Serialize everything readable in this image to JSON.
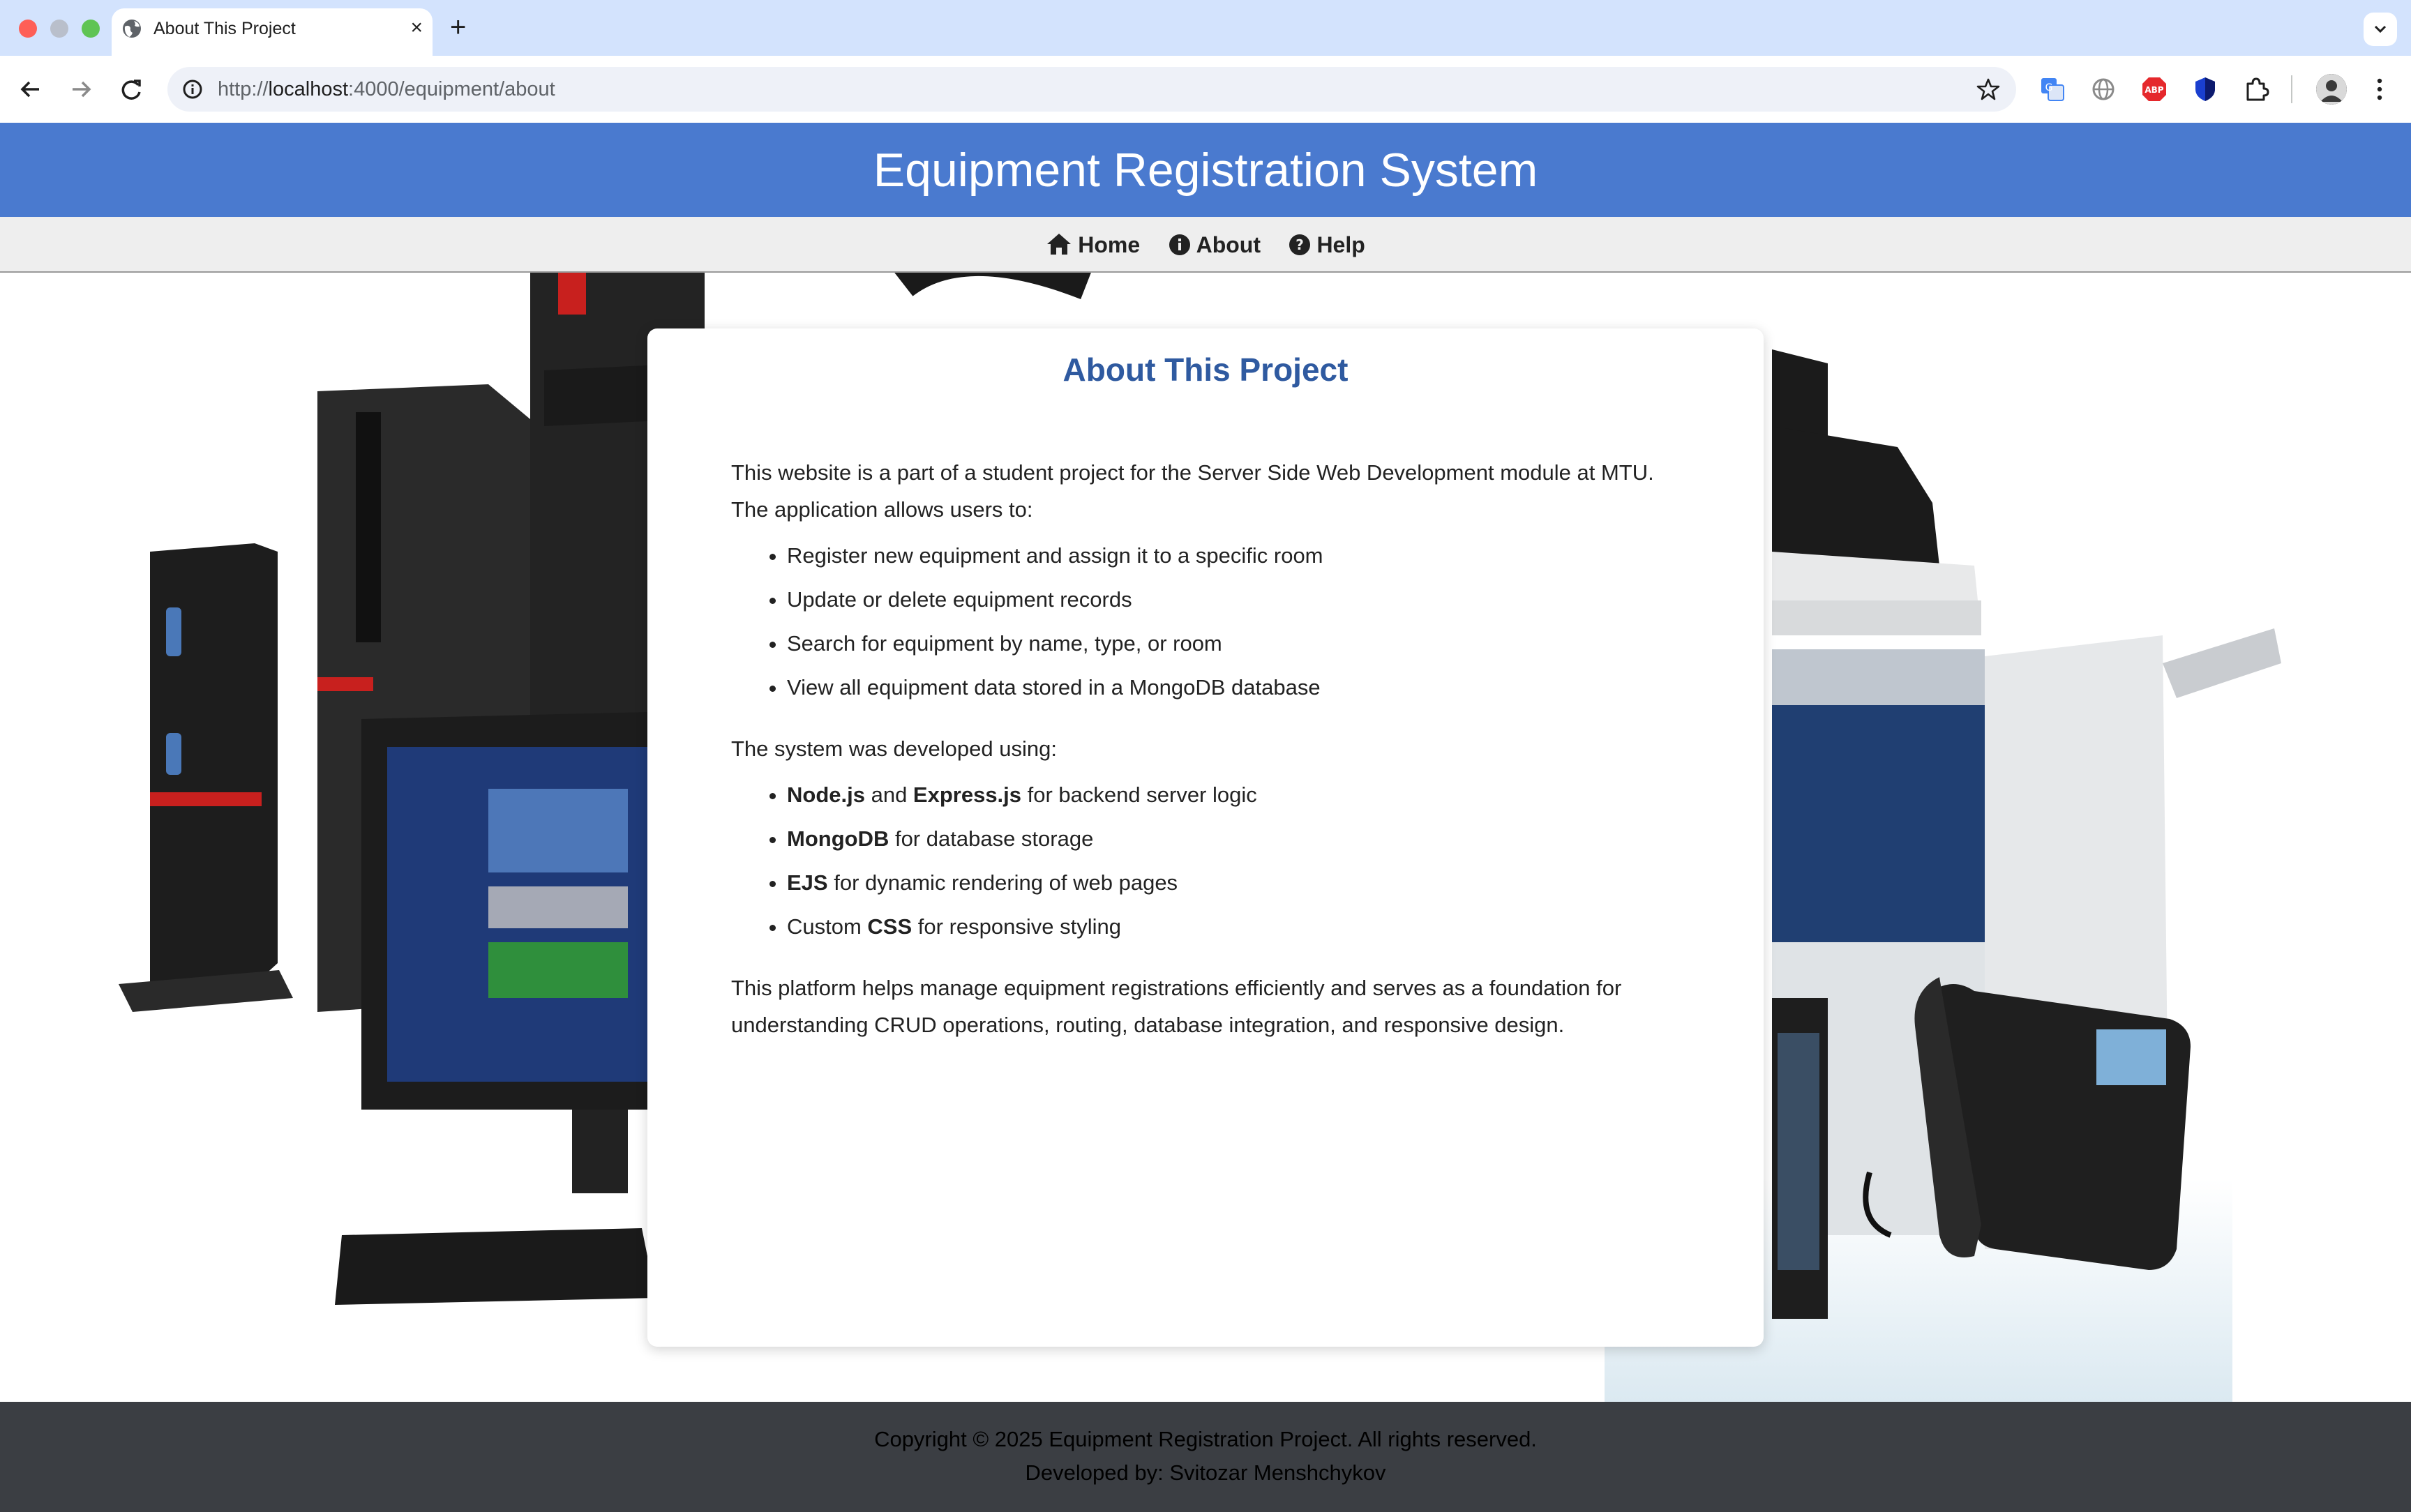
{
  "browser": {
    "tab_title": "About This Project",
    "tab_close": "×",
    "new_tab": "+",
    "tab_menu": "⌄",
    "url_scheme": "http://",
    "url_host": "localhost",
    "url_path": ":4000/equipment/about",
    "extensions": [
      "translate-icon",
      "globe-icon",
      "adblock-icon",
      "shield-icon",
      "puzzle-icon"
    ]
  },
  "header": {
    "title": "Equipment Registration System"
  },
  "nav": {
    "items": [
      {
        "label": "Home",
        "icon": "home-icon"
      },
      {
        "label": "About",
        "icon": "info-icon"
      },
      {
        "label": "Help",
        "icon": "help-icon"
      }
    ]
  },
  "content": {
    "title": "About This Project",
    "intro_1": "This website is a part of a student project for the Server Side Web Development module at MTU.",
    "intro_2": "The application allows users to:",
    "features": [
      "Register new equipment and assign it to a specific room",
      "Update or delete equipment records",
      "Search for equipment by name, type, or room",
      "View all equipment data stored in a MongoDB database"
    ],
    "tech_intro": "The system was developed using:",
    "tech": [
      {
        "pre": "",
        "b1": "Node.js",
        "mid": " and ",
        "b2": "Express.js",
        "post": " for backend server logic"
      },
      {
        "pre": "",
        "b1": "MongoDB",
        "mid": " for database storage",
        "b2": "",
        "post": ""
      },
      {
        "pre": "",
        "b1": "EJS",
        "mid": " for dynamic rendering of web pages",
        "b2": "",
        "post": ""
      },
      {
        "pre": "Custom ",
        "b1": "CSS",
        "mid": " for responsive styling",
        "b2": "",
        "post": ""
      }
    ],
    "outro_1": "This platform helps manage equipment registrations efficiently and serves as a foundation for",
    "outro_2": "understanding CRUD operations, routing, database integration, and responsive design."
  },
  "footer": {
    "copyright": "Copyright © 2025 Equipment Registration Project. All rights reserved.",
    "developer": "Developed by: Svitozar Menshchykov"
  },
  "colors": {
    "header_bg": "#4a7acf",
    "nav_bg": "#eeeeee",
    "title_blue": "#2f5aa0",
    "footer_bg": "#3b3e43"
  }
}
